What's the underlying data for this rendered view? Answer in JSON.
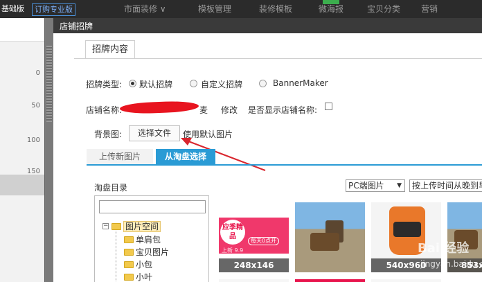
{
  "topbar": {
    "version_basic": "基础版",
    "version_pro": "订购专业版",
    "nav": [
      "市面装修 ∨",
      "模板管理",
      "装修模板",
      "微海报",
      "宝贝分类",
      "营销"
    ]
  },
  "ruler": {
    "marks": [
      "0",
      "50",
      "100",
      "150"
    ]
  },
  "dialog": {
    "title": "店铺招牌",
    "tab": "招牌内容",
    "sign_type_label": "招牌类型:",
    "sign_type_options": [
      {
        "label": "默认招牌",
        "checked": true
      },
      {
        "label": "自定义招牌",
        "checked": false
      },
      {
        "label": "BannerMaker",
        "checked": false
      }
    ],
    "shop_name_label": "店铺名称:",
    "shop_name_tail": "麦",
    "modify_link": "修改",
    "show_name_label": "是否显示店铺名称:",
    "show_name_checked": false,
    "bg_label": "背景图:",
    "choose_file": "选择文件",
    "use_default": "使用默认图片",
    "subtabs": {
      "upload": "上传新图片",
      "taobao": "从淘盘选择"
    },
    "dir_label": "淘盘目录",
    "select_pc": "PC端图片",
    "select_sort": "按上传时间从晚到早",
    "tree": {
      "root": "图片空间",
      "children": [
        "单肩包",
        "宝贝图片",
        "小包",
        "小叶"
      ]
    },
    "thumbnails": [
      {
        "caption": "248x146",
        "promo_title": "应季精品",
        "promo_sub": "每天0点开",
        "promo_price": "上新 9.9"
      },
      {
        "caption": ""
      },
      {
        "caption": "540x960"
      },
      {
        "caption": "853x"
      }
    ],
    "watermark": "Bai 经验",
    "watermark_url": "jingyan.baidu.com"
  }
}
